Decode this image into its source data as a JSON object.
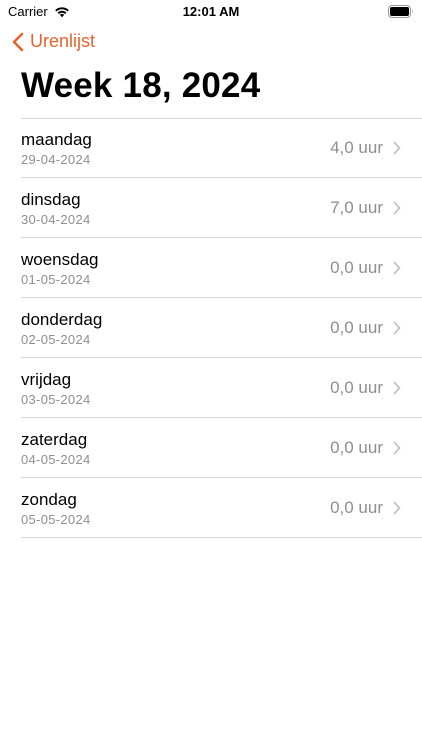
{
  "status_bar": {
    "carrier": "Carrier",
    "time": "12:01 AM"
  },
  "nav": {
    "back_label": "Urenlijst"
  },
  "title": "Week 18, 2024",
  "days": [
    {
      "name": "maandag",
      "date": "29-04-2024",
      "hours": "4,0 uur"
    },
    {
      "name": "dinsdag",
      "date": "30-04-2024",
      "hours": "7,0 uur"
    },
    {
      "name": "woensdag",
      "date": "01-05-2024",
      "hours": "0,0 uur"
    },
    {
      "name": "donderdag",
      "date": "02-05-2024",
      "hours": "0,0 uur"
    },
    {
      "name": "vrijdag",
      "date": "03-05-2024",
      "hours": "0,0 uur"
    },
    {
      "name": "zaterdag",
      "date": "04-05-2024",
      "hours": "0,0 uur"
    },
    {
      "name": "zondag",
      "date": "05-05-2024",
      "hours": "0,0 uur"
    }
  ],
  "icons": {
    "wifi": "wifi-icon",
    "battery": "battery-icon",
    "back": "chevron-left-icon",
    "row": "chevron-right-icon"
  },
  "colors": {
    "accent": "#e8642c",
    "secondary_text": "#8e8e93",
    "separator": "#d6d6da"
  }
}
